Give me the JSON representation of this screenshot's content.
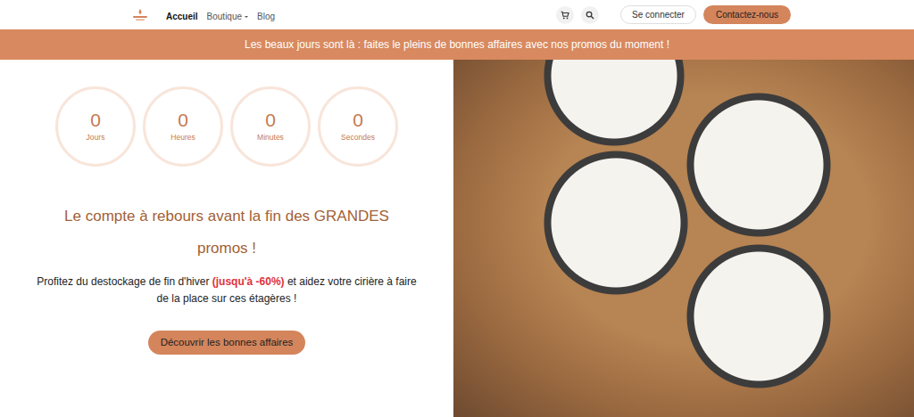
{
  "nav": {
    "items": [
      {
        "label": "Accueil",
        "selected": true,
        "kind": "link"
      },
      {
        "label": "Boutique",
        "selected": false,
        "kind": "dropdown"
      },
      {
        "label": "Blog",
        "selected": false,
        "kind": "link"
      }
    ]
  },
  "actions": {
    "login": "Se connecter",
    "contact": "Contactez-nous"
  },
  "banner": "Les beaux jours sont là : faites le pleins de bonnes affaires avec nos promos du moment !",
  "countdown": [
    {
      "value": "0",
      "unit": "Jours"
    },
    {
      "value": "0",
      "unit": "Heures"
    },
    {
      "value": "0",
      "unit": "Minutes"
    },
    {
      "value": "0",
      "unit": "Secondes"
    }
  ],
  "headline": "Le compte à rebours avant la fin des GRANDES promos !",
  "intro": {
    "before": "Profitez du destockage de fin d'hiver ",
    "highlight": "(jusqu'à -60%)",
    "after": " et aidez votre cirière à faire de la place sur ces étagères !"
  },
  "cta": "Découvrir les bonnes affaires"
}
